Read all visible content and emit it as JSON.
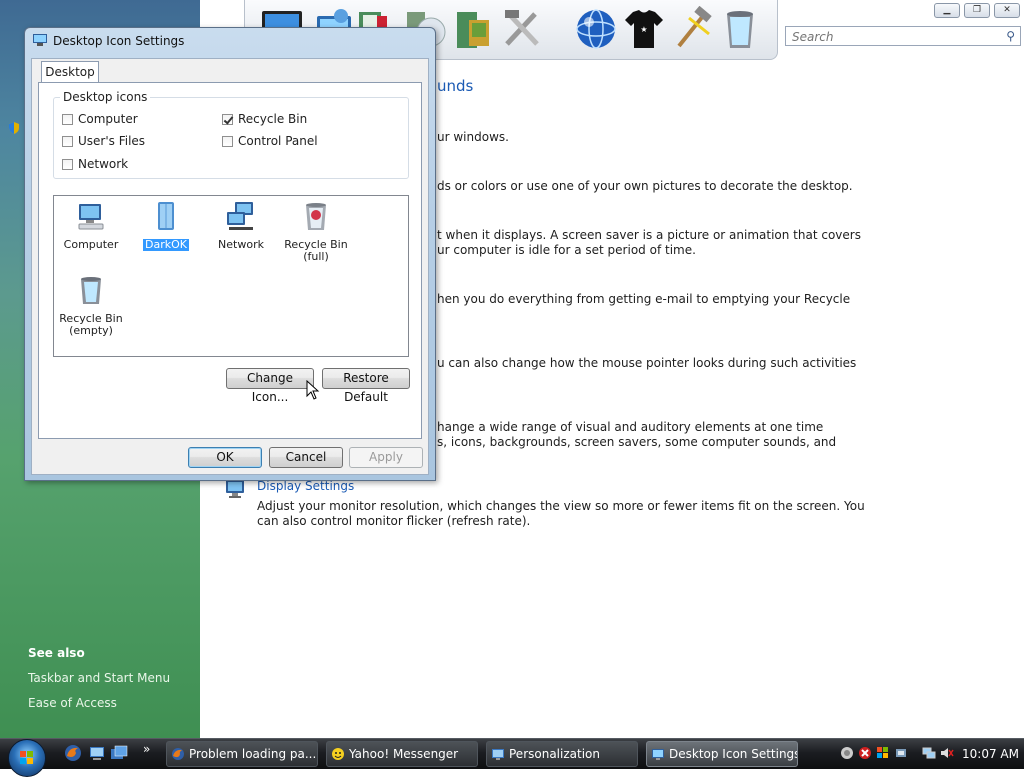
{
  "background_window": {
    "search_placeholder": "Search",
    "content_title_fragment": "unds",
    "text_lines": [
      "ur windows.",
      "ds or colors or use one of your own pictures to decorate the desktop.",
      "t when it displays. A screen saver is a picture or animation that covers",
      "ur computer is idle for a set period of time.",
      "hen you do everything from getting e-mail to emptying your Recycle",
      "u can also change how the mouse pointer looks during such activities",
      "hange a wide range of visual and auditory elements at one time",
      "s, icons, backgrounds, screen savers, some computer sounds, and"
    ],
    "display_settings": {
      "title": "Display Settings",
      "line1": "Adjust your monitor resolution, which changes the view so more or fewer items fit on the screen. You",
      "line2": "can also control monitor flicker (refresh rate)."
    },
    "sidebar": {
      "see_also": "See also",
      "links": [
        "Taskbar and Start Menu",
        "Ease of Access"
      ]
    }
  },
  "dialog": {
    "title": "Desktop Icon Settings",
    "tab": "Desktop",
    "group_label": "Desktop icons",
    "checkboxes": [
      {
        "label": "Computer",
        "checked": false
      },
      {
        "label": "User's Files",
        "checked": false
      },
      {
        "label": "Network",
        "checked": false
      },
      {
        "label": "Recycle Bin",
        "checked": true
      },
      {
        "label": "Control Panel",
        "checked": false
      }
    ],
    "icons": [
      {
        "label": "Computer",
        "selected": false
      },
      {
        "label": "DarkOK",
        "selected": true
      },
      {
        "label": "Network",
        "selected": false
      },
      {
        "label": "Recycle Bin (full)",
        "selected": false
      },
      {
        "label": "Recycle Bin (empty)",
        "selected": false
      }
    ],
    "buttons": {
      "change_icon": "Change Icon...",
      "restore_default": "Restore Default",
      "ok": "OK",
      "cancel": "Cancel",
      "apply": "Apply"
    }
  },
  "taskbar": {
    "tasks": [
      {
        "label": "Problem loading pa...",
        "icon": "firefox-icon"
      },
      {
        "label": "Yahoo! Messenger",
        "icon": "yahoo-messenger-icon"
      },
      {
        "label": "Personalization",
        "icon": "personalization-icon"
      },
      {
        "label": "Desktop Icon Settings",
        "icon": "desktop-icon-settings-icon",
        "active": true
      }
    ],
    "overflow": "»",
    "clock": "10:07 AM"
  },
  "colors": {
    "accent_link": "#1a5ab4",
    "selection": "#3399ff",
    "taskbar": "#1b1d21"
  }
}
